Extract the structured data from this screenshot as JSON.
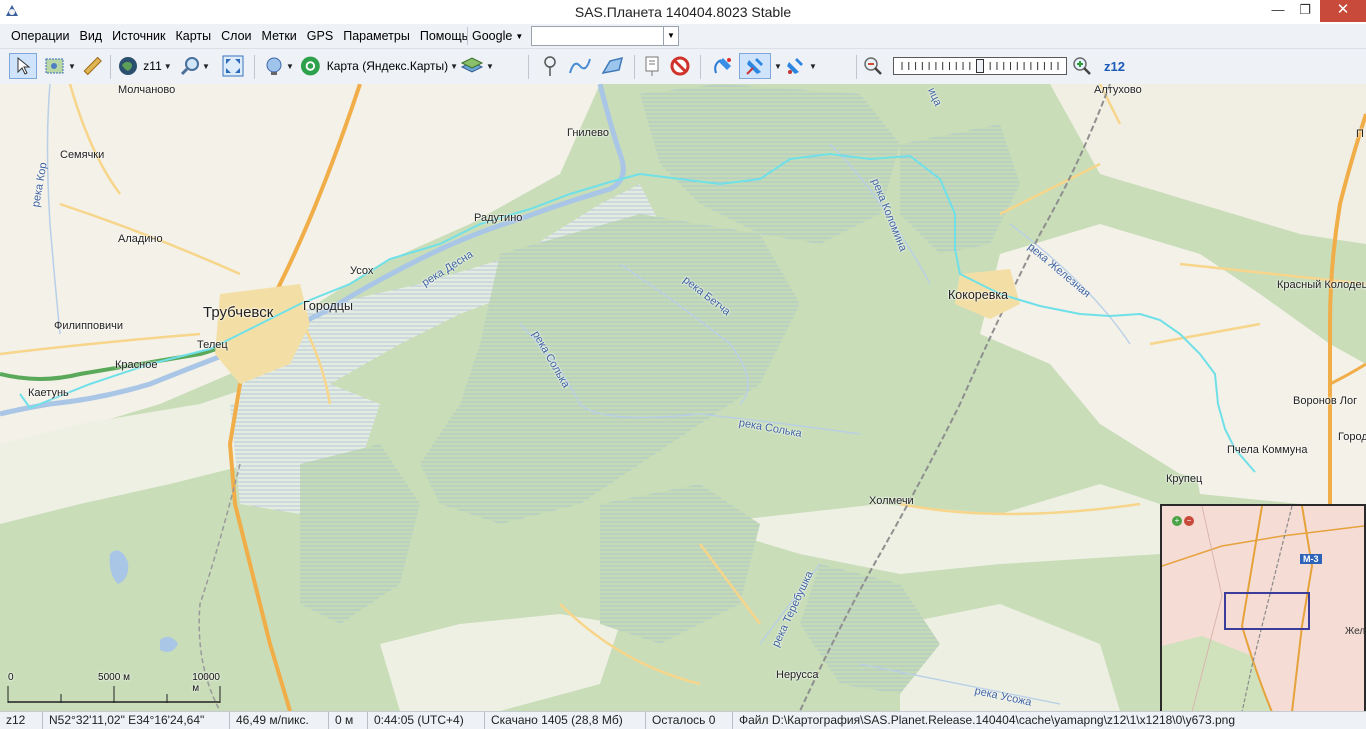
{
  "window": {
    "title": "SAS.Планета 140404.8023 Stable",
    "minimize": "—",
    "restore": "❐",
    "close": "✕"
  },
  "menu": {
    "items": [
      "Операции",
      "Вид",
      "Источник",
      "Карты",
      "Слои",
      "Метки",
      "GPS",
      "Параметры",
      "Помощь"
    ],
    "search_provider": "Google",
    "search_value": ""
  },
  "toolbar": {
    "zoom_select": "z11",
    "map_select": "Карта (Яндекс.Карты)",
    "zoom_level": "z12",
    "zoom_position": 0.5
  },
  "map_labels": {
    "places": [
      {
        "id": "molchanovo",
        "text": "Молчаново"
      },
      {
        "id": "semyachki",
        "text": "Семячки"
      },
      {
        "id": "aladino",
        "text": "Аладино"
      },
      {
        "id": "trubchevsk",
        "text": "Трубчевск"
      },
      {
        "id": "gorodcy",
        "text": "Городцы"
      },
      {
        "id": "usoh",
        "text": "Усох"
      },
      {
        "id": "radutino",
        "text": "Радутино"
      },
      {
        "id": "gnilevo",
        "text": "Гнилево"
      },
      {
        "id": "filippovichi",
        "text": "Филипповичи"
      },
      {
        "id": "telec",
        "text": "Телец"
      },
      {
        "id": "krasnoe",
        "text": "Красное"
      },
      {
        "id": "kaetun",
        "text": "Каетунь"
      },
      {
        "id": "kokorevka",
        "text": "Кокоревка"
      },
      {
        "id": "altuhovo",
        "text": "Алтухово"
      },
      {
        "id": "krasny_kolodec",
        "text": "Красный Колодец"
      },
      {
        "id": "voronov_log",
        "text": "Воронов Лог"
      },
      {
        "id": "gorod",
        "text": "Город"
      },
      {
        "id": "pchela",
        "text": "Пчела Коммуна"
      },
      {
        "id": "krupec",
        "text": "Крупец"
      },
      {
        "id": "holmechi",
        "text": "Холмечи"
      },
      {
        "id": "nerussa",
        "text": "Нерусса"
      },
      {
        "id": "p_edge",
        "text": "П"
      }
    ],
    "rivers": [
      {
        "id": "kor",
        "text": "река Кор"
      },
      {
        "id": "desna",
        "text": "река Десна"
      },
      {
        "id": "betcha",
        "text": "река Бетча"
      },
      {
        "id": "solka1",
        "text": "река Солька"
      },
      {
        "id": "solka2",
        "text": "река Солька"
      },
      {
        "id": "kolomina",
        "text": "река Коломина"
      },
      {
        "id": "zheleznaya",
        "text": "река Железная"
      },
      {
        "id": "terebushka",
        "text": "река Теребушка"
      },
      {
        "id": "usozha",
        "text": "река Усожа"
      },
      {
        "id": "top",
        "text": "ица"
      }
    ]
  },
  "minimap": {
    "road_label": "М-3",
    "town_label": "Жел",
    "plus": "+",
    "minus": "−"
  },
  "scale": {
    "zero": "0",
    "mid": "5000 м",
    "end": "10000 м"
  },
  "statusbar": {
    "zoom": "z12",
    "coords": "N52°32'11,02\" E34°16'24,64\"",
    "resolution": "46,49 м/пикс.",
    "distance": "0 м",
    "time": "0:44:05 (UTC+4)",
    "downloaded": "Скачано 1405 (28,8 Мб)",
    "remaining": "Осталось 0",
    "file": "Файл D:\\Картография\\SAS.Planet.Release.140404\\cache\\yamapng\\z12\\1\\x1218\\0\\y673.png"
  },
  "colors": {
    "forest": "#c5dbb5",
    "field": "#f3f1e8",
    "road_major": "#f0ad48",
    "road_minor": "#f7d58a",
    "water": "#a9c6e6",
    "track": "#6fe0e8",
    "highlight_road": "#5aa85a"
  }
}
